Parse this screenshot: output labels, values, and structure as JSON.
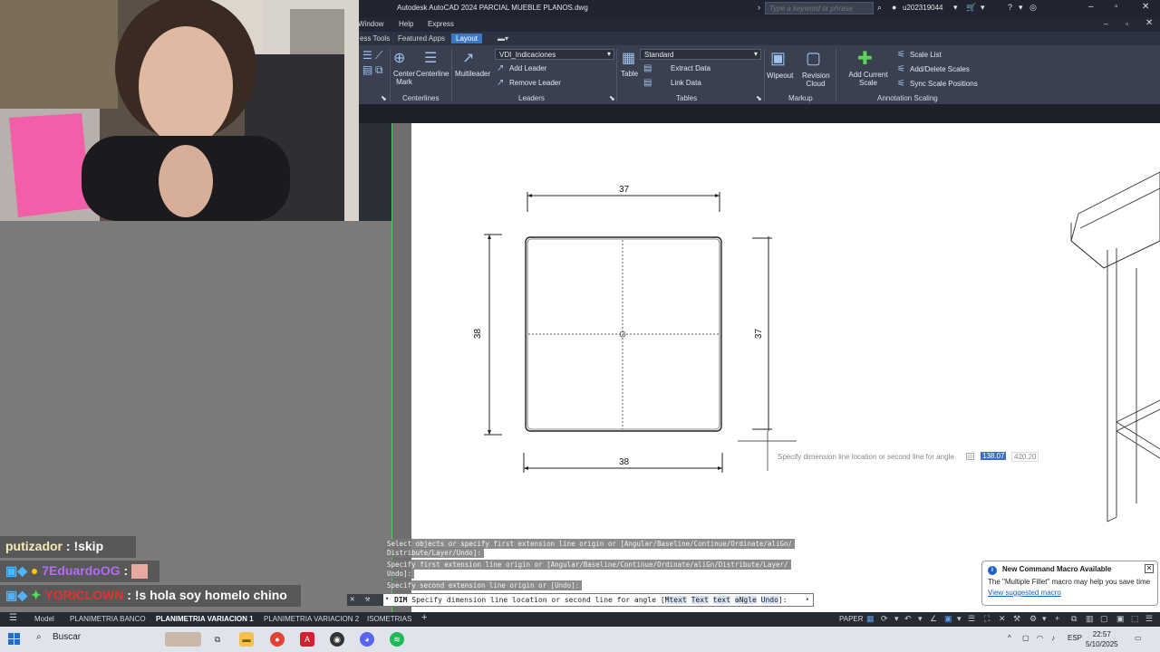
{
  "window": {
    "title": "Autodesk AutoCAD 2024   PARCIAL MUEBLE PLANOS.dwg",
    "search_placeholder": "Type a keyword or phrase",
    "user": "u202319044"
  },
  "menu": {
    "items": [
      "Window",
      "Help",
      "Express"
    ]
  },
  "ribbon_tabs": {
    "items": [
      "ess Tools",
      "Featured Apps",
      "Layout"
    ],
    "active": "Layout"
  },
  "ribbon": {
    "centerlines": {
      "center_mark": "Center Mark",
      "centerline": "Centerline",
      "panel": "Centerlines"
    },
    "leaders": {
      "multileader": "Multileader",
      "style": "VDI_Indicaciones",
      "add": "Add Leader",
      "remove": "Remove Leader",
      "panel": "Leaders"
    },
    "tables": {
      "table": "Table",
      "style": "Standard",
      "extract": "Extract Data",
      "link": "Link Data",
      "panel": "Tables"
    },
    "markup": {
      "wipeout": "Wipeout",
      "revision_cloud": "Revision Cloud",
      "panel": "Markup"
    },
    "annotation_scaling": {
      "add_current": "Add Current Scale",
      "scale_list": "Scale List",
      "add_delete": "Add/Delete Scales",
      "sync": "Sync Scale Positions",
      "panel": "Annotation Scaling"
    }
  },
  "drawing": {
    "dim_top": "37",
    "dim_left": "38",
    "dim_right": "37",
    "dim_bottom": "38",
    "tooltip_prompt": "Specify dimension line location or second line for angle",
    "tooltip_value1": "138.07",
    "tooltip_value2": "420.20"
  },
  "chat": [
    {
      "user": "putizador",
      "message": " : !skip",
      "color": "#f0e6b0"
    },
    {
      "user": "7EduardoOG",
      "message": " : ",
      "color": "#b26cf2"
    },
    {
      "user": "YORICLOWN",
      "message": " : !s hola soy homelo chino",
      "color": "#e53030"
    }
  ],
  "command": {
    "history": [
      "Select objects or specify first extension line origin or [Angular/Baseline/Continue/Ordinate/aliGn/",
      "Distribute/Layer/Undo]:",
      "Specify first extension line origin or [Angular/Baseline/Continue/Ordinate/aliGn/Distribute/Layer/",
      "Undo]:",
      "Specify second extension line origin or [Undo]:"
    ],
    "prefix": "DIM",
    "prompt": "Specify dimension line location or second line for angle [",
    "options": [
      "Mtext",
      "Text",
      "text",
      "aNgle",
      "Undo"
    ],
    "suffix": "]:"
  },
  "notification": {
    "title": "New Command Macro Available",
    "body": "The \"Multiple Fillet\" macro may help you save time",
    "link": "View suggested macro"
  },
  "layout_tabs": {
    "items": [
      "Model",
      "PLANIMETRIA BANCO",
      "PLANIMETRIA VARIACION 1",
      "PLANIMETRIA VARIACION 2",
      "ISOMETRIAS"
    ],
    "active": "PLANIMETRIA VARIACION 1"
  },
  "status": {
    "space": "PAPER"
  },
  "taskbar": {
    "search": "Buscar",
    "lang": "ESP",
    "time": "22:57",
    "date": "5/10/2025"
  }
}
